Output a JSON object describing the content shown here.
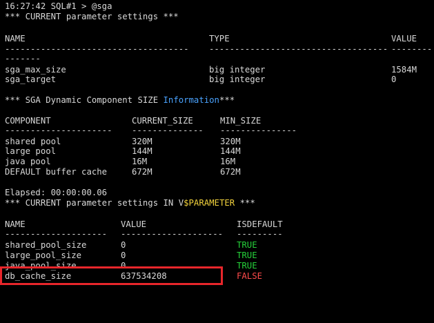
{
  "terminal": {
    "prompt_line": "16:27:42 SQL#1 > @sga",
    "section1": {
      "title": "*** CURRENT parameter settings ***",
      "headers": {
        "name": "NAME",
        "type": "TYPE",
        "value": "VALUE"
      },
      "dashes": {
        "name": "------------------------------------",
        "type": "-----------------------------------",
        "value": "--------",
        "wrap": "-------"
      },
      "rows": [
        {
          "name": "sga_max_size",
          "type": "big integer",
          "value": "1584M"
        },
        {
          "name": "sga_target",
          "type": "big integer",
          "value": "0"
        }
      ]
    },
    "section2": {
      "title_prefix": "*** SGA Dynamic Component SIZE ",
      "title_highlight": "Information",
      "title_suffix": "***",
      "headers": {
        "component": "COMPONENT",
        "current_size": "CURRENT_SIZE",
        "min_size": "MIN_SIZE"
      },
      "dashes": {
        "component": "---------------------",
        "current_size": "--------------",
        "min_size": "---------------"
      },
      "rows": [
        {
          "component": "shared pool",
          "current_size": "320M",
          "min_size": "320M"
        },
        {
          "component": "large pool",
          "current_size": "144M",
          "min_size": "144M"
        },
        {
          "component": "java pool",
          "current_size": "16M",
          "min_size": "16M"
        },
        {
          "component": "DEFAULT buffer cache",
          "current_size": "672M",
          "min_size": "672M"
        }
      ]
    },
    "elapsed": "Elapsed: 00:00:00.06",
    "section3": {
      "title_prefix": "*** CURRENT parameter settings IN V",
      "title_highlight": "$PARAMETER",
      "title_suffix": " ***",
      "headers": {
        "name": "NAME",
        "value": "VALUE",
        "isdefault": "ISDEFAULT"
      },
      "dashes": {
        "name": "--------------------",
        "value": "--------------------",
        "isdefault": "---------"
      },
      "rows": [
        {
          "name": "shared_pool_size",
          "value": "0",
          "isdefault": "TRUE"
        },
        {
          "name": "large_pool_size",
          "value": "0",
          "isdefault": "TRUE"
        },
        {
          "name": "java_pool_size",
          "value": "0",
          "isdefault": "TRUE"
        },
        {
          "name": "db_cache_size",
          "value": "637534208",
          "isdefault": "FALSE"
        }
      ]
    }
  },
  "colors": {
    "background": "#000000",
    "text": "#d8d8d8",
    "keyword_blue": "#4aa3ff",
    "keyword_yellow": "#f2d23c",
    "true_green": "#26d13a",
    "false_red": "#ff4b4b",
    "annotation_box": "#e8262b"
  }
}
